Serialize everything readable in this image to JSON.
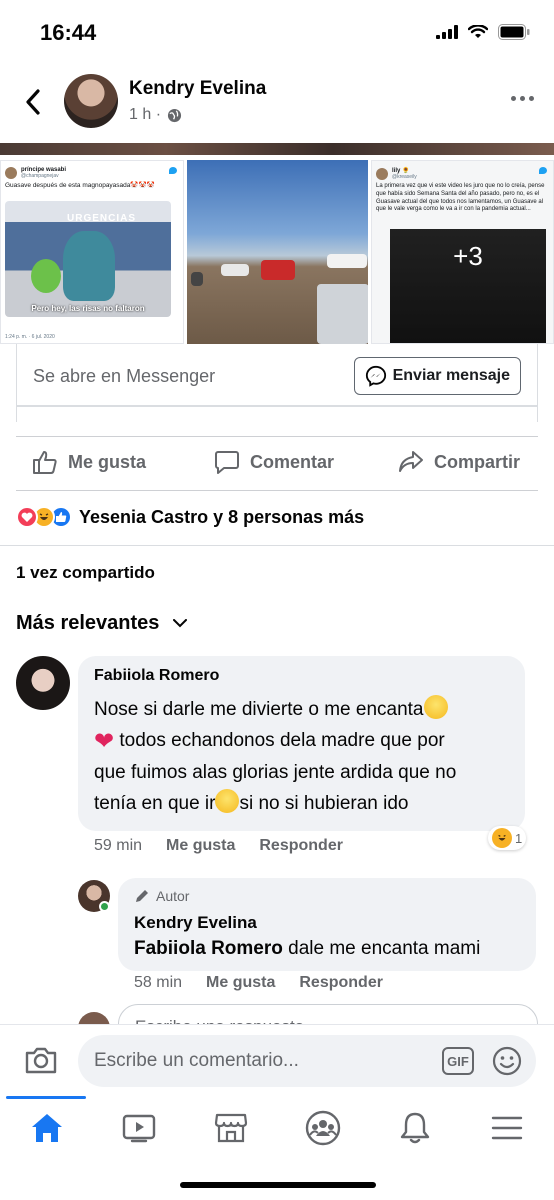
{
  "status_bar": {
    "time": "16:44"
  },
  "header": {
    "author": "Kendry Evelina",
    "time": "1 h ·"
  },
  "images": {
    "tile1": {
      "name": "príncipe wasabi",
      "handle": "@champagnejav",
      "text": "Guasave después de esta magnopayasada🤡🤡🤡",
      "meme_sign": "URGENCIAS",
      "meme_caption": "Pero hey, las risas no faltaron",
      "date": "1:24 p. m. · 6 jul. 2020"
    },
    "tile3": {
      "name": "lily 🌻",
      "handle": "@kreaseily",
      "text": "La primera vez que vi este video les juro que no lo creía, pense que había sido Semana Santa del año pasado, pero no, es el Guasave actual del que todos nos lamentamos, un Guasave al que le vale verga como le va a ir con la pandemia actual...",
      "more_count": "+3"
    }
  },
  "messenger": {
    "prompt": "Se abre en Messenger",
    "button": "Enviar mensaje"
  },
  "actions": {
    "like": "Me gusta",
    "comment": "Comentar",
    "share": "Compartir"
  },
  "reactions": {
    "summary": "Yesenia Castro y 8 personas más"
  },
  "shares": "1 vez compartido",
  "sort_label": "Más relevantes",
  "comments": [
    {
      "name": "Fabiiola Romero",
      "line1": "Nose si darle me divierte o me encanta",
      "line2": " todos echandonos dela madre que por",
      "line3": "que fuimos alas glorias jente ardida que no",
      "line4a": "tenía en que ir",
      "line4b": "si no si hubieran ido",
      "time": "59 min",
      "like": "Me gusta",
      "reply": "Responder",
      "reaction_count": "1"
    }
  ],
  "reply": {
    "badge": "Autor",
    "name": "Kendry Evelina",
    "mention": "Fabiiola Romero",
    "text": " dale me encanta mami",
    "time": "58 min",
    "like": "Me gusta",
    "reply": "Responder",
    "input_placeholder": "Escribe una respuesta..."
  },
  "composer": {
    "placeholder": "Escribe un comentario...",
    "gif": "GIF"
  },
  "colors": {
    "accent": "#1877f2",
    "secondary_text": "#65676b",
    "bubble": "#f0f2f5"
  }
}
